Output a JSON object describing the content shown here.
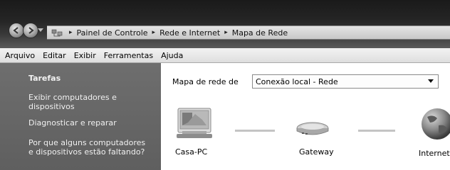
{
  "address_bar": {
    "crumbs": [
      "Painel de Controle",
      "Rede e Internet",
      "Mapa de Rede"
    ],
    "separator": "▸"
  },
  "menu": {
    "items": [
      "Arquivo",
      "Editar",
      "Exibir",
      "Ferramentas",
      "Ajuda"
    ]
  },
  "sidebar": {
    "title": "Tarefas",
    "links": [
      [
        "Exibir computadores e",
        "dispositivos"
      ],
      [
        "Diagnosticar e reparar"
      ],
      [
        "Por que alguns computadores",
        "e dispositivos estão faltando?"
      ]
    ]
  },
  "main": {
    "map_label": "Mapa de rede de",
    "dropdown": {
      "selected": "Conexão local - Rede"
    },
    "nodes": [
      {
        "label": "Casa-PC",
        "icon": "computer-icon"
      },
      {
        "label": "Gateway",
        "icon": "router-icon"
      },
      {
        "label": "Internet",
        "icon": "globe-icon"
      }
    ]
  },
  "colors": {
    "titlebar": "#262626",
    "sidebar": "#666666",
    "menubar": "#e6e6e6"
  }
}
